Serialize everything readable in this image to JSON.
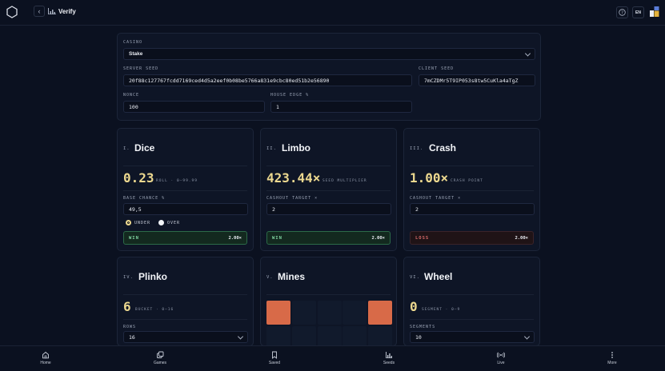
{
  "header": {
    "title": "Verify",
    "lang": "EN"
  },
  "config": {
    "casino_label": "CASINO",
    "casino_value": "Stake",
    "server_seed_label": "SERVER SEED",
    "server_seed_value": "20f88c127767fcdd7169ced4d5a2eef0b08be5766a831e9cbc80ed51b2e56890",
    "client_seed_label": "CLIENT SEED",
    "client_seed_value": "7mCZDMr5T9IP053s8tw5CuKla4aTgZ",
    "nonce_label": "NONCE",
    "nonce_value": "100",
    "house_edge_label": "HOUSE EDGE %",
    "house_edge_value": "1"
  },
  "games": {
    "dice": {
      "numeral": "I.",
      "name": "Dice",
      "result": "0.23",
      "result_caption": "ROLL · 0–99.99",
      "input_label": "BASE CHANCE %",
      "input_value": "49,5",
      "opt_under": "UNDER",
      "opt_over": "OVER",
      "outcome": "WIN",
      "multiplier": "2.00×"
    },
    "limbo": {
      "numeral": "II.",
      "name": "Limbo",
      "result": "423.44×",
      "result_caption": "SEED MULTIPLIER",
      "input_label": "CASHOUT TARGET ×",
      "input_value": "2",
      "outcome": "WIN",
      "multiplier": "2.00×"
    },
    "crash": {
      "numeral": "III.",
      "name": "Crash",
      "result": "1.00×",
      "result_caption": "CRASH POINT",
      "input_label": "CASHOUT TARGET ×",
      "input_value": "2",
      "outcome": "LOSS",
      "multiplier": "2.00×"
    },
    "plinko": {
      "numeral": "IV.",
      "name": "Plinko",
      "result": "6",
      "result_caption": "BUCKET · 0–16",
      "input_label": "ROWS",
      "input_value": "16"
    },
    "mines": {
      "numeral": "V.",
      "name": "Mines"
    },
    "wheel": {
      "numeral": "VI.",
      "name": "Wheel",
      "result": "0",
      "result_caption": "SEGMENT · 0–9",
      "input_label": "SEGMENTS",
      "input_value": "10"
    }
  },
  "bottom_nav": [
    "Home",
    "Games",
    "Saved",
    "Seeds",
    "Live",
    "More"
  ],
  "colors": {
    "background": "#0b1120",
    "panel": "#0e1526",
    "accent_gold": "#ecd88f",
    "win_green": "#7fd3a0",
    "loss_red": "#d66a6a",
    "mine_tile": "#d86a48"
  }
}
